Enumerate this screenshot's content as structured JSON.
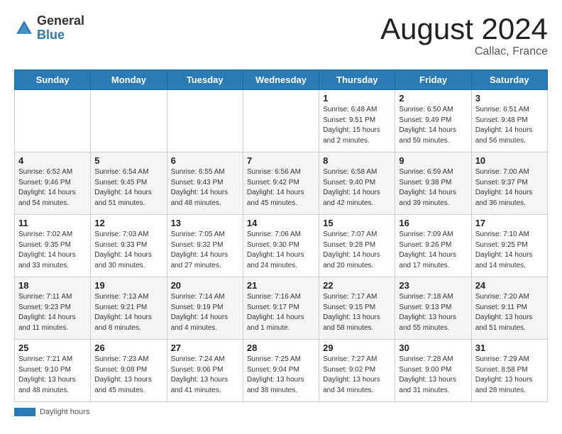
{
  "header": {
    "logo_general": "General",
    "logo_blue": "Blue",
    "month_title": "August 2024",
    "location": "Callac, France"
  },
  "days_of_week": [
    "Sunday",
    "Monday",
    "Tuesday",
    "Wednesday",
    "Thursday",
    "Friday",
    "Saturday"
  ],
  "weeks": [
    [
      {
        "day": "",
        "sunrise": "",
        "sunset": "",
        "daylight": ""
      },
      {
        "day": "",
        "sunrise": "",
        "sunset": "",
        "daylight": ""
      },
      {
        "day": "",
        "sunrise": "",
        "sunset": "",
        "daylight": ""
      },
      {
        "day": "",
        "sunrise": "",
        "sunset": "",
        "daylight": ""
      },
      {
        "day": "1",
        "sunrise": "Sunrise: 6:48 AM",
        "sunset": "Sunset: 9:51 PM",
        "daylight": "Daylight: 15 hours and 2 minutes."
      },
      {
        "day": "2",
        "sunrise": "Sunrise: 6:50 AM",
        "sunset": "Sunset: 9:49 PM",
        "daylight": "Daylight: 14 hours and 59 minutes."
      },
      {
        "day": "3",
        "sunrise": "Sunrise: 6:51 AM",
        "sunset": "Sunset: 9:48 PM",
        "daylight": "Daylight: 14 hours and 56 minutes."
      }
    ],
    [
      {
        "day": "4",
        "sunrise": "Sunrise: 6:52 AM",
        "sunset": "Sunset: 9:46 PM",
        "daylight": "Daylight: 14 hours and 54 minutes."
      },
      {
        "day": "5",
        "sunrise": "Sunrise: 6:54 AM",
        "sunset": "Sunset: 9:45 PM",
        "daylight": "Daylight: 14 hours and 51 minutes."
      },
      {
        "day": "6",
        "sunrise": "Sunrise: 6:55 AM",
        "sunset": "Sunset: 9:43 PM",
        "daylight": "Daylight: 14 hours and 48 minutes."
      },
      {
        "day": "7",
        "sunrise": "Sunrise: 6:56 AM",
        "sunset": "Sunset: 9:42 PM",
        "daylight": "Daylight: 14 hours and 45 minutes."
      },
      {
        "day": "8",
        "sunrise": "Sunrise: 6:58 AM",
        "sunset": "Sunset: 9:40 PM",
        "daylight": "Daylight: 14 hours and 42 minutes."
      },
      {
        "day": "9",
        "sunrise": "Sunrise: 6:59 AM",
        "sunset": "Sunset: 9:38 PM",
        "daylight": "Daylight: 14 hours and 39 minutes."
      },
      {
        "day": "10",
        "sunrise": "Sunrise: 7:00 AM",
        "sunset": "Sunset: 9:37 PM",
        "daylight": "Daylight: 14 hours and 36 minutes."
      }
    ],
    [
      {
        "day": "11",
        "sunrise": "Sunrise: 7:02 AM",
        "sunset": "Sunset: 9:35 PM",
        "daylight": "Daylight: 14 hours and 33 minutes."
      },
      {
        "day": "12",
        "sunrise": "Sunrise: 7:03 AM",
        "sunset": "Sunset: 9:33 PM",
        "daylight": "Daylight: 14 hours and 30 minutes."
      },
      {
        "day": "13",
        "sunrise": "Sunrise: 7:05 AM",
        "sunset": "Sunset: 9:32 PM",
        "daylight": "Daylight: 14 hours and 27 minutes."
      },
      {
        "day": "14",
        "sunrise": "Sunrise: 7:06 AM",
        "sunset": "Sunset: 9:30 PM",
        "daylight": "Daylight: 14 hours and 24 minutes."
      },
      {
        "day": "15",
        "sunrise": "Sunrise: 7:07 AM",
        "sunset": "Sunset: 9:28 PM",
        "daylight": "Daylight: 14 hours and 20 minutes."
      },
      {
        "day": "16",
        "sunrise": "Sunrise: 7:09 AM",
        "sunset": "Sunset: 9:26 PM",
        "daylight": "Daylight: 14 hours and 17 minutes."
      },
      {
        "day": "17",
        "sunrise": "Sunrise: 7:10 AM",
        "sunset": "Sunset: 9:25 PM",
        "daylight": "Daylight: 14 hours and 14 minutes."
      }
    ],
    [
      {
        "day": "18",
        "sunrise": "Sunrise: 7:11 AM",
        "sunset": "Sunset: 9:23 PM",
        "daylight": "Daylight: 14 hours and 11 minutes."
      },
      {
        "day": "19",
        "sunrise": "Sunrise: 7:13 AM",
        "sunset": "Sunset: 9:21 PM",
        "daylight": "Daylight: 14 hours and 8 minutes."
      },
      {
        "day": "20",
        "sunrise": "Sunrise: 7:14 AM",
        "sunset": "Sunset: 9:19 PM",
        "daylight": "Daylight: 14 hours and 4 minutes."
      },
      {
        "day": "21",
        "sunrise": "Sunrise: 7:16 AM",
        "sunset": "Sunset: 9:17 PM",
        "daylight": "Daylight: 14 hours and 1 minute."
      },
      {
        "day": "22",
        "sunrise": "Sunrise: 7:17 AM",
        "sunset": "Sunset: 9:15 PM",
        "daylight": "Daylight: 13 hours and 58 minutes."
      },
      {
        "day": "23",
        "sunrise": "Sunrise: 7:18 AM",
        "sunset": "Sunset: 9:13 PM",
        "daylight": "Daylight: 13 hours and 55 minutes."
      },
      {
        "day": "24",
        "sunrise": "Sunrise: 7:20 AM",
        "sunset": "Sunset: 9:11 PM",
        "daylight": "Daylight: 13 hours and 51 minutes."
      }
    ],
    [
      {
        "day": "25",
        "sunrise": "Sunrise: 7:21 AM",
        "sunset": "Sunset: 9:10 PM",
        "daylight": "Daylight: 13 hours and 48 minutes."
      },
      {
        "day": "26",
        "sunrise": "Sunrise: 7:23 AM",
        "sunset": "Sunset: 9:08 PM",
        "daylight": "Daylight: 13 hours and 45 minutes."
      },
      {
        "day": "27",
        "sunrise": "Sunrise: 7:24 AM",
        "sunset": "Sunset: 9:06 PM",
        "daylight": "Daylight: 13 hours and 41 minutes."
      },
      {
        "day": "28",
        "sunrise": "Sunrise: 7:25 AM",
        "sunset": "Sunset: 9:04 PM",
        "daylight": "Daylight: 13 hours and 38 minutes."
      },
      {
        "day": "29",
        "sunrise": "Sunrise: 7:27 AM",
        "sunset": "Sunset: 9:02 PM",
        "daylight": "Daylight: 13 hours and 34 minutes."
      },
      {
        "day": "30",
        "sunrise": "Sunrise: 7:28 AM",
        "sunset": "Sunset: 9:00 PM",
        "daylight": "Daylight: 13 hours and 31 minutes."
      },
      {
        "day": "31",
        "sunrise": "Sunrise: 7:29 AM",
        "sunset": "Sunset: 8:58 PM",
        "daylight": "Daylight: 13 hours and 28 minutes."
      }
    ]
  ],
  "footer": {
    "daylight_label": "Daylight hours"
  }
}
